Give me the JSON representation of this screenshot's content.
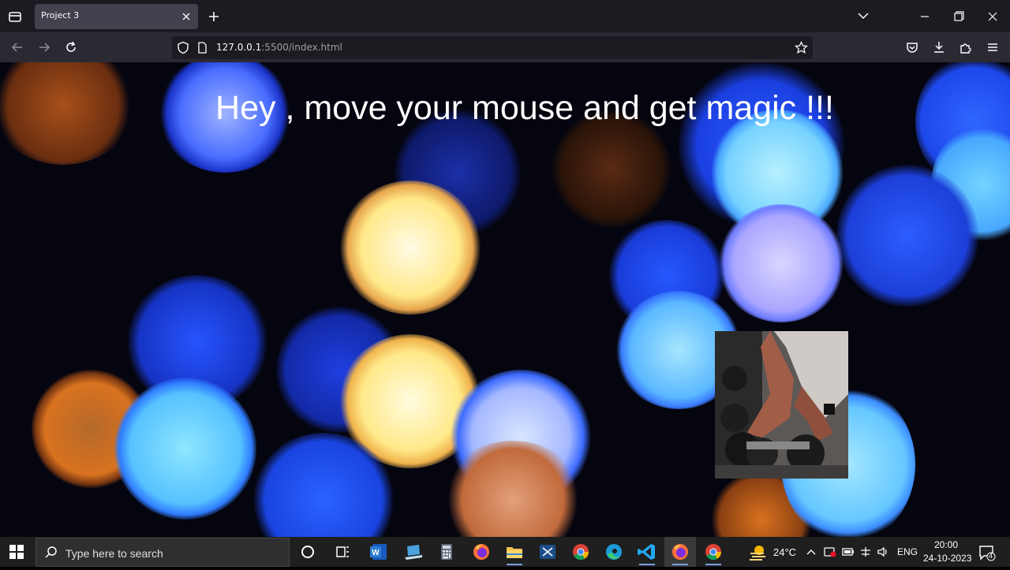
{
  "browser": {
    "tab_title": "Project 3",
    "url_host": "127.0.0.1",
    "url_path": ":5500/index.html"
  },
  "page": {
    "headline": "Hey , move your mouse and get magic !!!",
    "photo_subject": "dumbbell-rack-photo"
  },
  "taskbar": {
    "search_placeholder": "Type here to search",
    "weather": "24°C",
    "language": "ENG",
    "time": "20:00",
    "date": "24-10-2023",
    "notification_count": "4"
  },
  "colors": {
    "tabbar_bg": "#1c1b22",
    "navbar_bg": "#2b2a33",
    "taskbar_bg": "#1f1f1f",
    "bokeh_blue": "#2b5cff",
    "bokeh_cyan": "#66ccff",
    "bokeh_orange": "#d9721f",
    "bokeh_yellow": "#ffe88a"
  }
}
